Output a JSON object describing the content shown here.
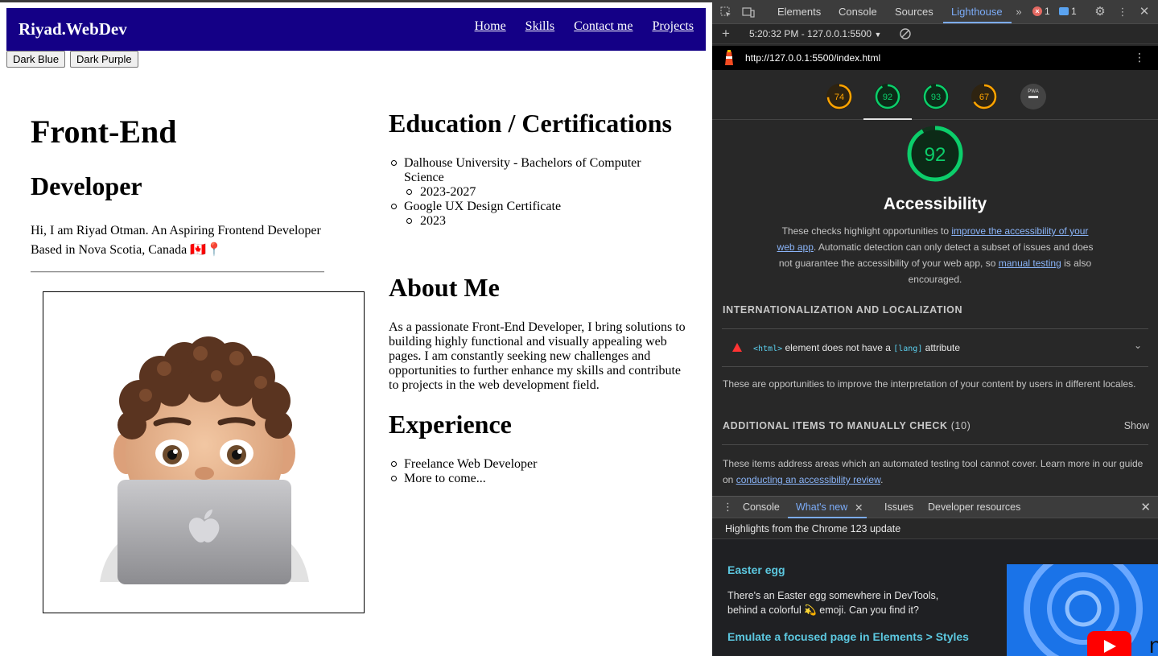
{
  "site": {
    "brand": "Riyad.WebDev",
    "nav": [
      "Home",
      "Skills",
      "Contact me",
      "Projects"
    ],
    "theme_buttons": [
      "Dark Blue",
      "Dark Purple"
    ],
    "hero": {
      "title": "Front-End",
      "subtitle": "Developer",
      "intro": "Hi, I am Riyad Otman. An Aspiring Frontend Developer Based in Nova Scotia, Canada 🇨🇦📍"
    },
    "education": {
      "heading": "Education / Certifications",
      "items": [
        {
          "name": "Dalhouse University - Bachelors of Computer Science",
          "sub": "2023-2027"
        },
        {
          "name": "Google UX Design Certificate",
          "sub": "2023"
        }
      ]
    },
    "about": {
      "heading": "About Me",
      "text": "As a passionate Front-End Developer, I bring solutions to building highly functional and visually appealing web pages. I am constantly seeking new challenges and opportunities to further enhance my skills and contribute to projects in the web development field."
    },
    "experience": {
      "heading": "Experience",
      "items": [
        "Freelance Web Developer",
        "More to come..."
      ]
    },
    "colors": {
      "navbar": "#140086"
    }
  },
  "devtools": {
    "tabs": [
      "Elements",
      "Console",
      "Sources",
      "Lighthouse"
    ],
    "active_tab": "Lighthouse",
    "errors_count": "1",
    "messages_count": "1",
    "run_label": "5:20:32 PM - 127.0.0.1:5500",
    "url": "http://127.0.0.1:5500/index.html",
    "scores": [
      74,
      92,
      93,
      67
    ],
    "pwa_label": "PWA",
    "active_category": "Accessibility",
    "accessibility": {
      "score": "92",
      "title": "Accessibility",
      "desc_1": "These checks highlight opportunities to ",
      "link_1": "improve the accessibility of your web app",
      "desc_2": ". Automatic detection can only detect a subset of issues and does not guarantee the accessibility of your web app, so ",
      "link_2": "manual testing",
      "desc_3": " is also encouraged."
    },
    "group_intl": {
      "title": "INTERNATIONALIZATION AND LOCALIZATION",
      "audit_code_1": "<html>",
      "audit_text_1": " element does not have a ",
      "audit_code_2": "[lang]",
      "audit_text_2": " attribute",
      "description": "These are opportunities to improve the interpretation of your content by users in different locales."
    },
    "group_manual": {
      "title": "ADDITIONAL ITEMS TO MANUALLY CHECK",
      "count": "(10)",
      "show_label": "Show",
      "desc_1": "These items address areas which an automated testing tool cannot cover. Learn more in our guide on ",
      "link": "conducting an accessibility review",
      "desc_2": "."
    },
    "drawer": {
      "tabs": [
        "Console",
        "What's new",
        "Issues",
        "Developer resources"
      ],
      "active_tab": "What's new",
      "highlights": "Highlights from the Chrome 123 update",
      "items": [
        {
          "title": "Easter egg",
          "desc": "There's an Easter egg somewhere in DevTools, behind a colorful 💫 emoji. Can you find it?"
        },
        {
          "title": "Emulate a focused page in Elements > Styles"
        }
      ]
    },
    "colors": {
      "good": "#0cce6b",
      "average": "#ffa400",
      "accent": "#7cacf8",
      "link": "#8ab4f8"
    }
  }
}
